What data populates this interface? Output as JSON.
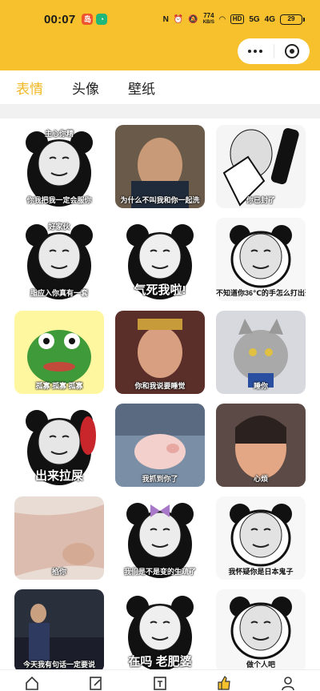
{
  "status_bar": {
    "time": "00:07",
    "net_speed_value": "774",
    "net_speed_unit": "KB/S",
    "hd": "HD",
    "signal1": "5G",
    "signal2": "4G",
    "battery": "29"
  },
  "tabs": [
    {
      "label": "表情",
      "active": true
    },
    {
      "label": "头像",
      "active": false
    },
    {
      "label": "壁纸",
      "active": false
    }
  ],
  "tiles": [
    {
      "caption": "你我把我一定会服你",
      "top_caption": "主心你精",
      "style": "panda"
    },
    {
      "caption": "为什么不叫我和你一起洗",
      "style": "photo"
    },
    {
      "caption": "你已封了",
      "style": "phone"
    },
    {
      "caption": "脂应入你真有一套",
      "top_caption": "好家伙",
      "style": "panda"
    },
    {
      "caption": "气死我啦!",
      "style": "panda-big"
    },
    {
      "caption": "不知道你36℃的手怎么打出这么冰冷的文字",
      "style": "panda-light"
    },
    {
      "caption": "孤寡 孤寡 孤寡",
      "style": "frog"
    },
    {
      "caption": "你和我说要睡觉",
      "style": "monkey"
    },
    {
      "caption": "睡你",
      "style": "cat"
    },
    {
      "caption": "出来拉屎",
      "style": "panda-phone"
    },
    {
      "caption": "我抓到你了",
      "style": "pig"
    },
    {
      "caption": "心烦",
      "style": "girl"
    },
    {
      "caption": "掐你",
      "style": "arm"
    },
    {
      "caption": "我们是不是变的生疏了",
      "style": "panda-bow"
    },
    {
      "caption": "我怀疑你是日本鬼子",
      "style": "panda-light"
    },
    {
      "caption": "今天我有句话一定要说",
      "style": "man"
    },
    {
      "caption": "在吗 老肥婆",
      "style": "panda-big"
    },
    {
      "caption": "做个人吧",
      "style": "panda-light"
    }
  ],
  "colors": {
    "header": "#f6c12c",
    "active_tab": "#f2b824"
  },
  "capsule": {
    "menu_icon": "more-dots-icon",
    "close_icon": "target-circle-icon"
  },
  "bottom_nav": [
    "home-icon",
    "edit-icon",
    "scan-icon",
    "thumb-icon",
    "user-icon"
  ]
}
